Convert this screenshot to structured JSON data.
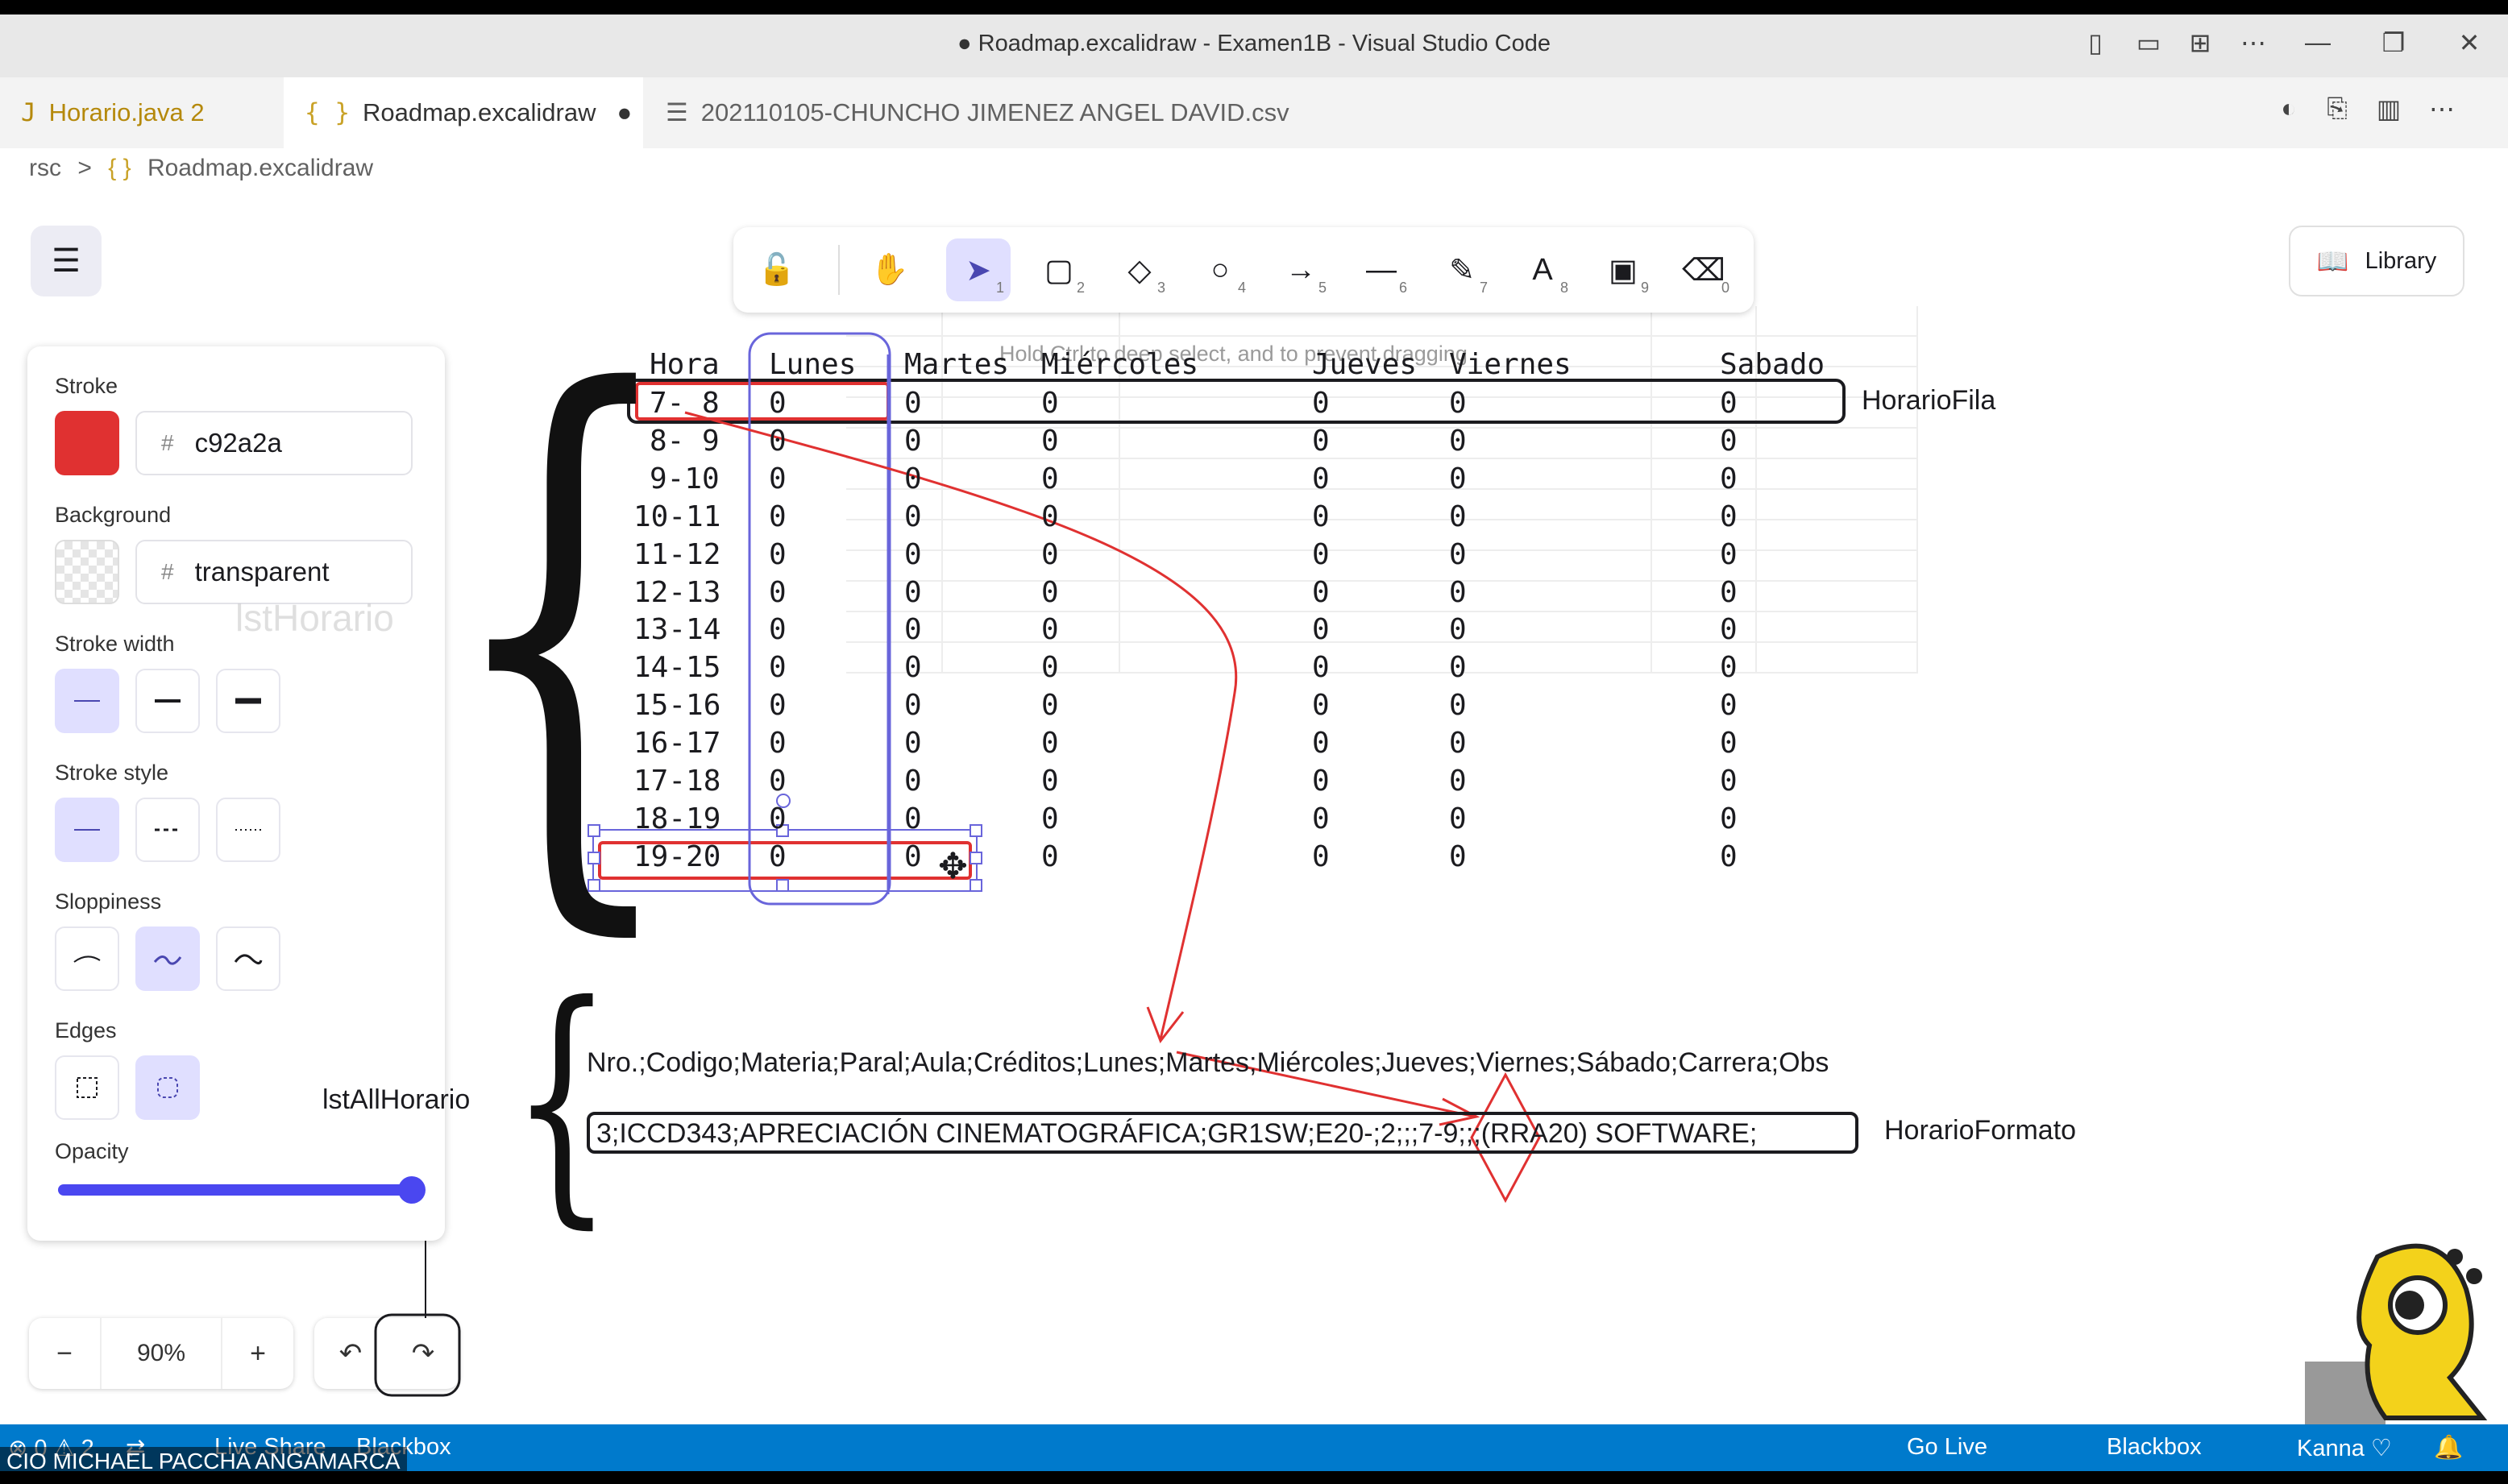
{
  "window": {
    "title": "● Roadmap.excalidraw - Examen1B - Visual Studio Code",
    "controls": [
      "—",
      "❐",
      "✕"
    ]
  },
  "tabs": [
    {
      "label": "Horario.java 2",
      "icon": "J"
    },
    {
      "label": "Roadmap.excalidraw",
      "icon": "{ }",
      "dirty": "●"
    },
    {
      "label": "202110105-CHUNCHO JIMENEZ ANGEL DAVID.csv",
      "icon": "☰"
    }
  ],
  "breadcrumb": [
    "rsc",
    ">",
    "{ }",
    "Roadmap.excalidraw"
  ],
  "toolbar": {
    "tools": [
      {
        "name": "lock-icon",
        "glyph": "🔓",
        "num": ""
      },
      {
        "name": "hand-icon",
        "glyph": "✋",
        "num": ""
      },
      {
        "name": "selection-icon",
        "glyph": "➤",
        "num": "1"
      },
      {
        "name": "rectangle-icon",
        "glyph": "▢",
        "num": "2"
      },
      {
        "name": "diamond-icon",
        "glyph": "◇",
        "num": "3"
      },
      {
        "name": "ellipse-icon",
        "glyph": "○",
        "num": "4"
      },
      {
        "name": "arrow-icon",
        "glyph": "→",
        "num": "5"
      },
      {
        "name": "line-icon",
        "glyph": "—",
        "num": "6"
      },
      {
        "name": "pencil-icon",
        "glyph": "✎",
        "num": "7"
      },
      {
        "name": "text-icon",
        "glyph": "A",
        "num": "8"
      },
      {
        "name": "image-icon",
        "glyph": "▣",
        "num": "9"
      },
      {
        "name": "eraser-icon",
        "glyph": "⌫",
        "num": "0"
      }
    ],
    "hint": "Hold Ctrl to deep select, and to prevent dragging",
    "library_label": "Library"
  },
  "properties": {
    "stroke_label": "Stroke",
    "stroke_hex": "c92a2a",
    "stroke_color": "#e03131",
    "background_label": "Background",
    "background_hex": "transparent",
    "stroke_width_label": "Stroke width",
    "stroke_style_label": "Stroke style",
    "sloppiness_label": "Sloppiness",
    "edges_label": "Edges",
    "opacity_label": "Opacity",
    "hash": "#"
  },
  "zoom": {
    "minus": "−",
    "value": "90%",
    "plus": "+",
    "undo": "↶",
    "redo": "↷"
  },
  "canvas": {
    "header": [
      "Hora",
      "Lunes",
      "Martes",
      "Miércoles",
      "Jueves",
      "Viernes",
      "Sabado"
    ],
    "hours": [
      "7- 8",
      "8- 9",
      "9-10",
      "10-11",
      "11-12",
      "12-13",
      "13-14",
      "14-15",
      "15-16",
      "16-17",
      "17-18",
      "18-19",
      "19-20"
    ],
    "zero": "0",
    "label_fila": "HorarioFila",
    "label_formato": "HorarioFormato",
    "label_lsthorario": "lstHorario",
    "label_lstall": "lstAllHorario",
    "csv_header": "Nro.;Codigo;Materia;Paral;Aula;Créditos;Lunes;Martes;Miércoles;Jueves;Viernes;Sábado;Carrera;Obs",
    "csv_row": "3;ICCD343;APRECIACIÓN CINEMATOGRÁFICA;GR1SW;E20-;2;;;7-9;;;(RRA20) SOFTWARE;",
    "stroke_red": "#e03131",
    "select_blue": "#6965db"
  },
  "statusbar": {
    "left": [
      "⊗ 0 ⚠ 2",
      "⇄",
      "Live Share",
      "Blackbox"
    ],
    "right": [
      "Go Live",
      "Blackbox",
      "Kanna ♡",
      "🔔"
    ],
    "overlay_name": "CIO MICHAEL PACCHA ANGAMARCA"
  }
}
